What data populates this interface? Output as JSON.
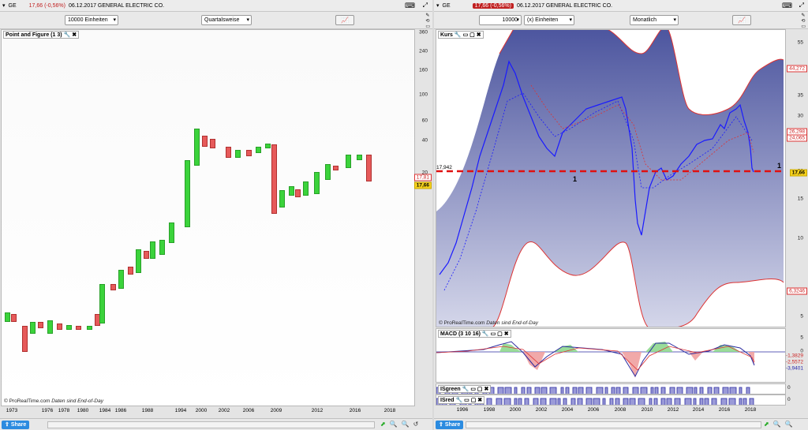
{
  "left": {
    "symbol": "GE",
    "price": "17,66 (-0,56%)",
    "date_title": "06.12.2017 GENERAL ELECTRIC CO.",
    "units_dropdown": "10000 Einheiten",
    "period_dropdown": "Quartalsweise",
    "panel_title": "Point and Figure (1 3)",
    "watermark": "© ProRealTime.com",
    "watermark_note": "Daten sind End-of-Day",
    "y_ticks": [
      "360",
      "240",
      "160",
      "100",
      "60",
      "40",
      "20"
    ],
    "price_box_other": "17,81",
    "price_box_current": "17,66",
    "x_ticks": [
      "1973",
      "1976",
      "1978",
      "1980",
      "1984",
      "1986",
      "1988",
      "1994",
      "2000",
      "2002",
      "2006",
      "2009",
      "2012",
      "2016",
      "2018"
    ],
    "share": "Share"
  },
  "right": {
    "symbol": "GE",
    "price": "17,66 (-0,56%)",
    "date_title": "06.12.2017 GENERAL ELECTRIC CO.",
    "qty": "10000",
    "qty_units": "(x) Einheiten",
    "period_dropdown": "Monatlich",
    "panel_title": "Kurs",
    "watermark": "© ProRealTime.com",
    "watermark_note": "Daten sind End-of-Day",
    "y_ticks": [
      "55",
      "50",
      "35",
      "30",
      "25",
      "20",
      "15",
      "10",
      "5"
    ],
    "price_labels": {
      "upper": "44,272",
      "mid1": "26,298",
      "mid2": "24,065",
      "current": "17,66",
      "lower": "6,3246"
    },
    "hline_label": "17,942",
    "mark1": "1",
    "mark2": "1",
    "macd_title": "MACD (3 10 16)",
    "macd_ticks": [
      "5",
      "0"
    ],
    "macd_labels": [
      "-1,3829",
      "-2,5572",
      "-3,9401"
    ],
    "isgreen_title": "ISgreen",
    "isgreen_val": "0",
    "isred_title": "ISred",
    "isred_val": "0",
    "x_ticks": [
      "1996",
      "1998",
      "2000",
      "2002",
      "2004",
      "2006",
      "2008",
      "2010",
      "2012",
      "2014",
      "2016",
      "2018"
    ],
    "share": "Share"
  },
  "colors": {
    "pf_up": "#3bd33b",
    "pf_down": "#e65a5a",
    "band": "#5a63a8",
    "price_up": "#1a1aff",
    "price_down": "#d82020",
    "hline": "#e01010"
  }
}
